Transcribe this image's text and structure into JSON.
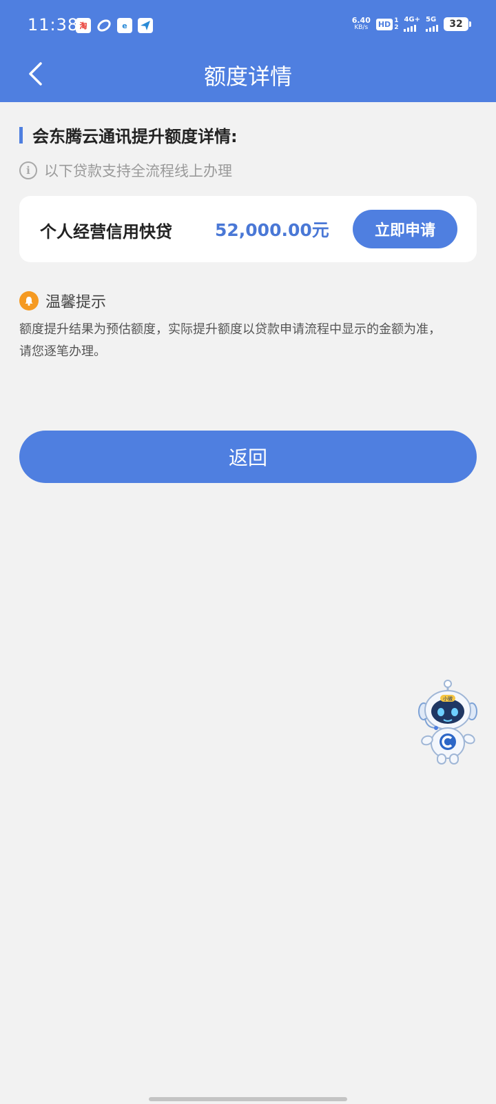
{
  "status_bar": {
    "time": "11:38",
    "app_icons": [
      "taobao-icon",
      "ring-app-icon",
      "ebank-icon",
      "plane-app-icon"
    ],
    "taobao_glyph": "淘",
    "ebank_glyph": "e",
    "net_speed": "6.40",
    "net_speed_unit": "KB/s",
    "hd_label": "HD",
    "hd_top": "1",
    "hd_bottom": "2",
    "signal_1": "4G+",
    "signal_2": "5G",
    "battery": "32"
  },
  "navbar": {
    "title": "额度详情",
    "back_icon": "chevron-left-icon"
  },
  "section": {
    "title": "会东腾云通讯提升额度详情:"
  },
  "info": {
    "icon": "info-circle-icon",
    "glyph": "i",
    "text": "以下贷款支持全流程线上办理"
  },
  "loan_card": {
    "name": "个人经营信用快贷",
    "amount": "52,000.00元",
    "apply_label": "立即申请"
  },
  "tip": {
    "icon": "bell-icon",
    "title": "温馨提示",
    "line1": "额度提升结果为预估额度，实际提升额度以贷款申请流程中显示的金额为准，",
    "line2": "请您逐笔办理。"
  },
  "return_button": {
    "label": "返回"
  },
  "assistant": {
    "icon": "robot-assistant-icon",
    "badge": "小微"
  },
  "colors": {
    "primary": "#4f7fe0",
    "amount": "#4a78d6",
    "background": "#f2f2f2",
    "tip_icon": "#f59a22"
  }
}
